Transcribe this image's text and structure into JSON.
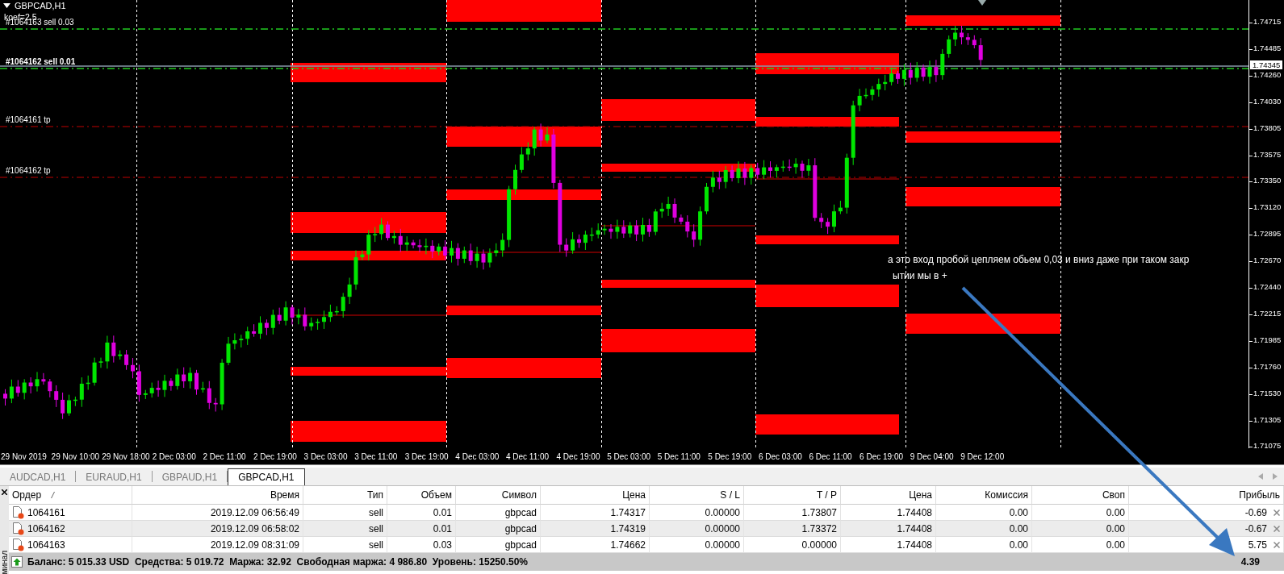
{
  "chart": {
    "title": "GBPCAD,H1",
    "indicator": "koef=2.5",
    "order_lines": [
      {
        "label": "#1064163 sell 0.03",
        "kind": "entry"
      },
      {
        "label": "#1064162 sell 0.01",
        "kind": "entry"
      },
      {
        "label": "#1064161 tp",
        "kind": "tp"
      },
      {
        "label": "#1064162 tp",
        "kind": "tp"
      }
    ],
    "annotation": [
      "а это вход пробой цепляем обьем 0,03 и вниз даже при таком закр",
      "ытии мы в +"
    ],
    "price_axis": [
      {
        "label": "1.74715",
        "kind": "tick"
      },
      {
        "label": "1.74485",
        "kind": "tick"
      },
      {
        "label": "1.74345",
        "kind": "current"
      },
      {
        "label": "1.74260",
        "kind": "tick"
      },
      {
        "label": "1.74030",
        "kind": "tick"
      },
      {
        "label": "1.73805",
        "kind": "tick"
      },
      {
        "label": "1.73575",
        "kind": "tick"
      },
      {
        "label": "1.73350",
        "kind": "tick"
      },
      {
        "label": "1.73120",
        "kind": "tick"
      },
      {
        "label": "1.72895",
        "kind": "tick"
      },
      {
        "label": "1.72670",
        "kind": "tick"
      },
      {
        "label": "1.72440",
        "kind": "tick"
      },
      {
        "label": "1.72215",
        "kind": "tick"
      },
      {
        "label": "1.71985",
        "kind": "tick"
      },
      {
        "label": "1.71760",
        "kind": "tick"
      },
      {
        "label": "1.71530",
        "kind": "tick"
      },
      {
        "label": "1.71305",
        "kind": "tick"
      },
      {
        "label": "1.71075",
        "kind": "tick"
      }
    ],
    "time_axis": [
      "29 Nov 2019",
      "29 Nov 10:00",
      "29 Nov 18:00",
      "2 Dec 03:00",
      "2 Dec 11:00",
      "2 Dec 19:00",
      "3 Dec 03:00",
      "3 Dec 11:00",
      "3 Dec 19:00",
      "4 Dec 03:00",
      "4 Dec 11:00",
      "4 Dec 19:00",
      "5 Dec 03:00",
      "5 Dec 11:00",
      "5 Dec 19:00",
      "6 Dec 03:00",
      "6 Dec 11:00",
      "6 Dec 19:00",
      "9 Dec 04:00",
      "9 Dec 12:00"
    ]
  },
  "tabs": [
    {
      "label": "AUDCAD,H1",
      "selected": false
    },
    {
      "label": "EURAUD,H1",
      "selected": false
    },
    {
      "label": "GBPAUD,H1",
      "selected": false
    },
    {
      "label": "GBPCAD,H1",
      "selected": true
    }
  ],
  "terminal": {
    "side_label": "минал",
    "columns": [
      "Ордер",
      "Время",
      "Тип",
      "Объем",
      "Символ",
      "Цена",
      "S / L",
      "T / P",
      "Цена",
      "Комиссия",
      "Своп",
      "Прибыль"
    ],
    "rows": [
      {
        "cells": [
          "1064161",
          "2019.12.09 06:56:49",
          "sell",
          "0.01",
          "gbpcad",
          "1.74317",
          "0.00000",
          "1.73807",
          "1.74408",
          "0.00",
          "0.00",
          "-0.69"
        ]
      },
      {
        "cells": [
          "1064162",
          "2019.12.09 06:58:02",
          "sell",
          "0.01",
          "gbpcad",
          "1.74319",
          "0.00000",
          "1.73372",
          "1.74408",
          "0.00",
          "0.00",
          "-0.67"
        ]
      },
      {
        "cells": [
          "1064163",
          "2019.12.09 08:31:09",
          "sell",
          "0.03",
          "gbpcad",
          "1.74662",
          "0.00000",
          "0.00000",
          "1.74408",
          "0.00",
          "0.00",
          "5.75"
        ]
      }
    ],
    "summary": "Баланс: 5 015.33 USD  Средства: 5 019.72  Маржа: 32.92  Свободная маржа: 4 986.80  Уровень: 15250.50%",
    "total": "4.39"
  }
}
